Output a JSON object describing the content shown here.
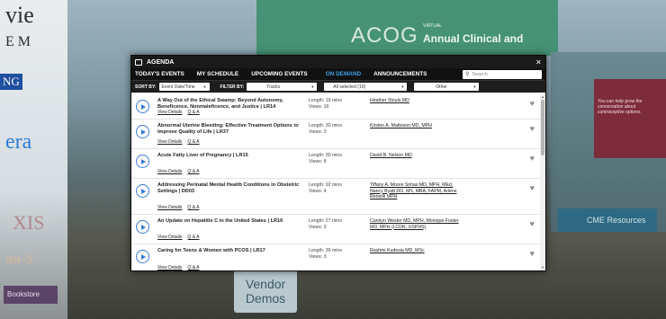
{
  "background": {
    "sponsors": [
      "vie",
      "EM",
      "NG",
      "era",
      "XIS",
      "an-S"
    ],
    "acog": "ACOG",
    "virtual_tag": "VIRTUAL",
    "annual_title": "Annual Clinical and",
    "right_banner": "You can help grow the conversation about contraceptive options.",
    "cme": "CME Resources",
    "vendor": "Vendor Demos",
    "bookstore": "Bookstore"
  },
  "modal": {
    "title": "AGENDA",
    "close": "×",
    "tabs": [
      "TODAY'S EVENTS",
      "MY SCHEDULE",
      "UPCOMING EVENTS",
      "ON DEMAND",
      "ANNOUNCEMENTS"
    ],
    "active_tab": "ON DEMAND",
    "search_placeholder": "Search",
    "filters": {
      "sort_label": "SORT BY:",
      "sort_value": "Event Date/Time",
      "filter_label": "FILTER BY:",
      "tracks": "Tracks",
      "selected": "All selected (19)",
      "other": "Other"
    },
    "sessions": [
      {
        "title": "A Way Out of the Ethical Swamp: Beyond Autonomy, Beneficence, Nonmaleficence, and Justice | LR14",
        "length": "Length: 19 mins",
        "views": "Views: 16",
        "speakers": "Heather Stouls MD",
        "details": "View Details",
        "qa": "Q & A"
      },
      {
        "title": "Abnormal Uterine Bleeding: Effective Treatment Options to Improve Quality of Life | LR37",
        "length": "Length: 30 mins",
        "views": "Views: 3",
        "speakers": "Kirsten A. Matteson MD, MPH",
        "details": "View Details",
        "qa": "Q & A"
      },
      {
        "title": "Acute Fatty Liver of Pregnancy | LR15",
        "length": "Length: 30 mins",
        "views": "Views: 8",
        "speakers": "David B. Nelson MD",
        "details": "View Details",
        "qa": "Q & A"
      },
      {
        "title": "Addressing Perinatal Mental Health Conditions in Obstetric Settings | DD03",
        "length": "Length: 92 mins",
        "views": "Views: 4",
        "speakers": "Tiffany A. Moore Simas MD, MPH, MEd, Nancy Byatt DO, MS, MBA, FAPM, Arlene Renelik MPH",
        "details": "View Details",
        "qa": "Q & A"
      },
      {
        "title": "An Update on Hepatitis C in the United States | LR16",
        "length": "Length: 27 mins",
        "views": "Views: 3",
        "speakers": "Carolyn Wester MD, MPH, Monique Foster MD, MPH (LCDR, USPHS)",
        "details": "View Details",
        "qa": "Q & A"
      },
      {
        "title": "Caring for Teens & Women with PCOS | LR17",
        "length": "Length: 39 mins",
        "views": "Views: 3",
        "speakers": "Rashmi Kudesia MD, MSc",
        "details": "View Details",
        "qa": "Q & A"
      }
    ]
  }
}
